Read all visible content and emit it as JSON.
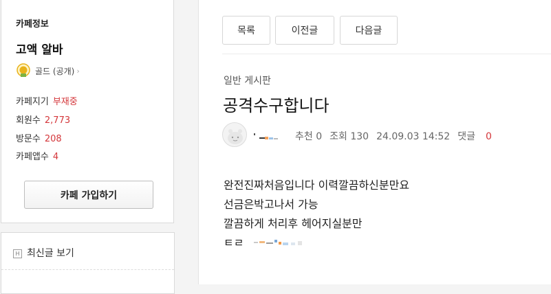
{
  "sidebar": {
    "cafe_info_title": "카페정보",
    "cafe_name": "고액 알바",
    "grade": "골드 (공개)",
    "stats": [
      {
        "label": "카페지기",
        "value": "부재중"
      },
      {
        "label": "회원수",
        "value": "2,773"
      },
      {
        "label": "방문수",
        "value": "208"
      },
      {
        "label": "카페앱수",
        "value": "4"
      }
    ],
    "join_button": "카페 가입하기",
    "recent_label": "최신글 보기"
  },
  "nav": {
    "list": "목록",
    "prev": "이전글",
    "next": "다음글"
  },
  "post": {
    "board": "일반 게시판",
    "title": "공격수구합니다",
    "meta": {
      "likes": "추천 0",
      "views": "조회 130",
      "date": "24.09.03 14:52",
      "comments_label": "댓글",
      "comments_count": "0"
    },
    "body": [
      "완전진짜처음입니다 이력깔끔하신분만요",
      "선금은박고나서 가능",
      "깔끔하게 처리후 헤어지실분만",
      "ㅌㄹ"
    ]
  },
  "colors": {
    "accent_red": "#d4363a",
    "medal_gold": "#e8b21a"
  }
}
